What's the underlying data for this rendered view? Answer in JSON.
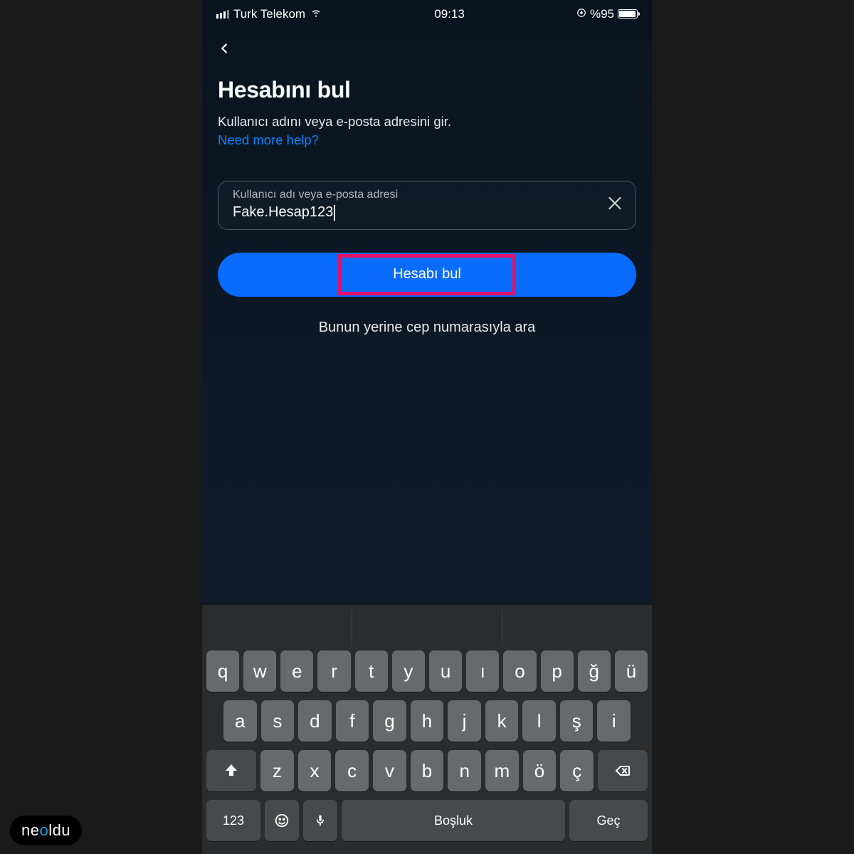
{
  "status": {
    "carrier": "Turk Telekom",
    "time": "09:13",
    "battery_text": "%95"
  },
  "page": {
    "title": "Hesabını bul",
    "subtitle": "Kullanıcı adını veya e-posta adresini gir.",
    "help_link": "Need more help?"
  },
  "input": {
    "label": "Kullanıcı adı veya e-posta adresi",
    "value": "Fake.Hesap123"
  },
  "primary_button": "Hesabı bul",
  "alt_link": "Bunun yerine cep numarasıyla ara",
  "keyboard": {
    "row1": [
      "q",
      "w",
      "e",
      "r",
      "t",
      "y",
      "u",
      "ı",
      "o",
      "p",
      "ğ",
      "ü"
    ],
    "row2": [
      "a",
      "s",
      "d",
      "f",
      "g",
      "h",
      "j",
      "k",
      "l",
      "ş",
      "i"
    ],
    "row3": [
      "z",
      "x",
      "c",
      "v",
      "b",
      "n",
      "m",
      "ö",
      "ç"
    ],
    "numbers_key": "123",
    "space_key": "Boşluk",
    "return_key": "Geç"
  },
  "watermark": {
    "pre": "ne",
    "accent": "o",
    "post": "ldu"
  }
}
